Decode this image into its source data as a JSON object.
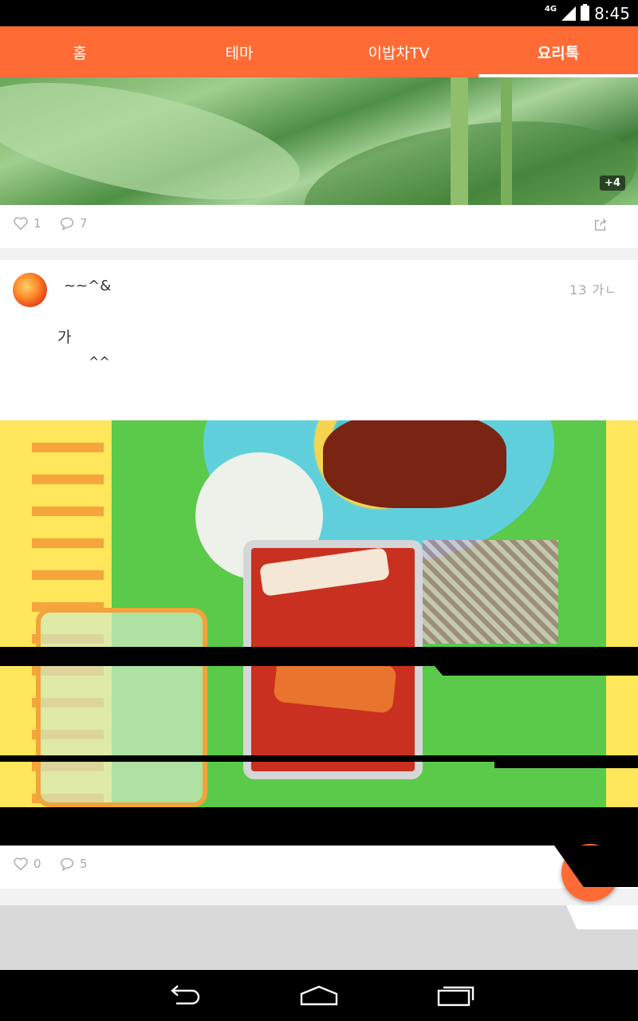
{
  "status_bar": {
    "network": "4G",
    "time": "8:45"
  },
  "tabs": [
    {
      "label": "홈",
      "active": false
    },
    {
      "label": "테마",
      "active": false
    },
    {
      "label": "이밥차TV",
      "active": false
    },
    {
      "label": "요리톡",
      "active": true
    }
  ],
  "post_1": {
    "more_photos_badge": "+4",
    "likes": "1",
    "comments": "7"
  },
  "post_2": {
    "author": "~~^&",
    "time": "13 가ㄴ",
    "body_line_1": "가",
    "body_line_2": "^^",
    "likes": "0",
    "comments": "5"
  },
  "colors": {
    "accent": "#ff6b34",
    "tab_text": "#ffffff",
    "meta_text": "#aaaaaa"
  },
  "icons": {
    "like": "heart-icon",
    "comment": "comment-icon",
    "share": "share-icon",
    "back": "back-icon",
    "home": "home-icon",
    "recents": "recents-icon"
  }
}
